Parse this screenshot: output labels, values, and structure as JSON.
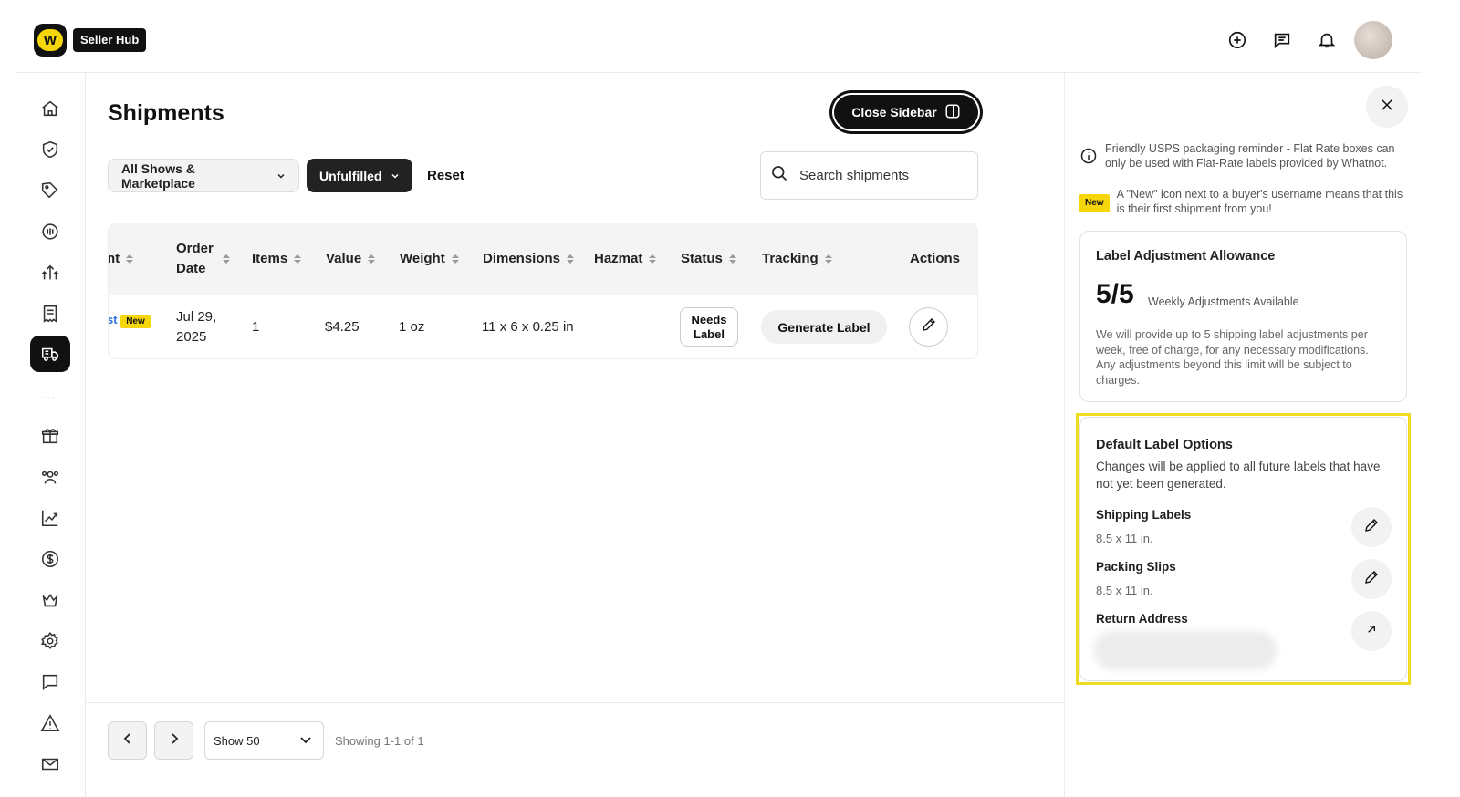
{
  "app": {
    "badge": "Seller Hub",
    "logo_icon": "whatnot-logo"
  },
  "topbar": {
    "icons": [
      "plus-circle-icon",
      "chat-icon",
      "bell-icon"
    ]
  },
  "nav": {
    "items": [
      "home-icon",
      "shield-check-icon",
      "tag-icon",
      "live-icon",
      "tree-icon",
      "receipt-icon",
      "truck-icon",
      "more-icon",
      "gift-icon",
      "users-icon",
      "chart-icon",
      "dollar-icon",
      "crown-icon",
      "gear-icon",
      "message-icon",
      "warning-icon",
      "mail-icon"
    ],
    "more_label": "...",
    "active": "truck-icon"
  },
  "main": {
    "title": "Shipments",
    "close_sidebar_label": "Close Sidebar",
    "filters": {
      "shows": "All Shows & Marketplace",
      "status": "Unfulfilled",
      "reset": "Reset"
    },
    "search": {
      "placeholder": "Search shipments"
    },
    "table": {
      "columns": {
        "buyer": "nt",
        "order_date": "Order Date",
        "items": "Items",
        "value": "Value",
        "weight": "Weight",
        "dimensions": "Dimensions",
        "hazmat": "Hazmat",
        "status": "Status",
        "tracking": "Tracking",
        "actions": "Actions"
      },
      "rows": [
        {
          "buyer": "st",
          "buyer_badge": "New",
          "order_date_line1": "Jul 29,",
          "order_date_line2": "2025",
          "items": "1",
          "value": "$4.25",
          "weight": "1 oz",
          "dimensions": "11 x 6 x 0.25 in",
          "hazmat": "",
          "status_line1": "Needs",
          "status_line2": "Label",
          "tracking_action": "Generate Label"
        }
      ]
    },
    "pagination": {
      "page_size": "Show 50",
      "showing": "Showing 1-1 of 1"
    }
  },
  "sidebar": {
    "info_text": "Friendly USPS packaging reminder - Flat Rate boxes can only be used with Flat-Rate labels provided by Whatnot.",
    "new_badge": "New",
    "new_text": "A \"New\" icon next to a buyer's username means that this is their first shipment from you!",
    "allowance": {
      "title": "Label Adjustment Allowance",
      "count": "5/5",
      "count_label": "Weekly Adjustments Available",
      "description": "We will provide up to 5 shipping label adjustments per week, free of charge, for any necessary modifications. Any adjustments beyond this limit will be subject to charges."
    },
    "defaults": {
      "title": "Default Label Options",
      "description": "Changes will be applied to all future labels that have not yet been generated.",
      "shipping_labels": {
        "title": "Shipping Labels",
        "value": "8.5 x 11 in."
      },
      "packing_slips": {
        "title": "Packing Slips",
        "value": "8.5 x 11 in."
      },
      "return_address": {
        "title": "Return Address"
      }
    },
    "highlight_color": "#f0dc1e"
  }
}
